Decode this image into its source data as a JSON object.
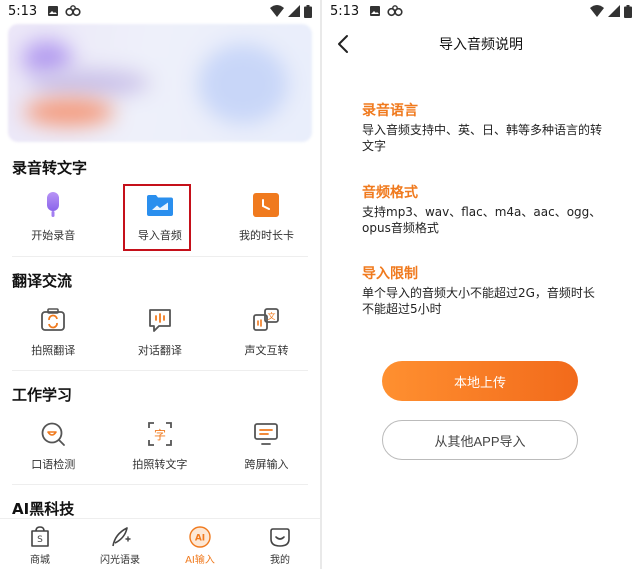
{
  "left": {
    "status_time": "5:13",
    "sections": [
      {
        "title": "录音转文字",
        "items": [
          {
            "label": "开始录音",
            "icon": "microphone-icon"
          },
          {
            "label": "导入音频",
            "icon": "folder-icon"
          },
          {
            "label": "我的时长卡",
            "icon": "clock-card-icon"
          }
        ]
      },
      {
        "title": "翻译交流",
        "items": [
          {
            "label": "拍照翻译",
            "icon": "photo-translate-icon"
          },
          {
            "label": "对话翻译",
            "icon": "dialog-translate-icon"
          },
          {
            "label": "声文互转",
            "icon": "voice-text-icon"
          }
        ]
      },
      {
        "title": "工作学习",
        "items": [
          {
            "label": "口语检测",
            "icon": "speech-test-icon"
          },
          {
            "label": "拍照转文字",
            "icon": "photo-to-text-icon"
          },
          {
            "label": "跨屏输入",
            "icon": "cross-screen-icon"
          }
        ]
      },
      {
        "title": "AI黑科技",
        "items": []
      }
    ],
    "tabs": [
      {
        "label": "商城",
        "icon": "shop-icon"
      },
      {
        "label": "闪光语录",
        "icon": "quill-icon"
      },
      {
        "label": "AI输入",
        "icon": "ai-input-icon",
        "active": true
      },
      {
        "label": "我的",
        "icon": "profile-icon"
      }
    ],
    "ai_badge": "AI"
  },
  "right": {
    "status_time": "5:13",
    "title": "导入音频说明",
    "blocks": [
      {
        "heading": "录音语言",
        "body": "导入音频支持中、英、日、韩等多种语言的转文字"
      },
      {
        "heading": "音频格式",
        "body": "支持mp3、wav、flac、m4a、aac、ogg、opus音频格式"
      },
      {
        "heading": "导入限制",
        "body": "单个导入的音频大小不能超过2G，音频时长不能超过5小时"
      }
    ],
    "primary_button": "本地上传",
    "secondary_button": "从其他APP导入"
  },
  "colors": {
    "accent": "#f07a1e",
    "highlight": "#c5101a",
    "purple": "#a678f0",
    "blue": "#2a8fee"
  }
}
